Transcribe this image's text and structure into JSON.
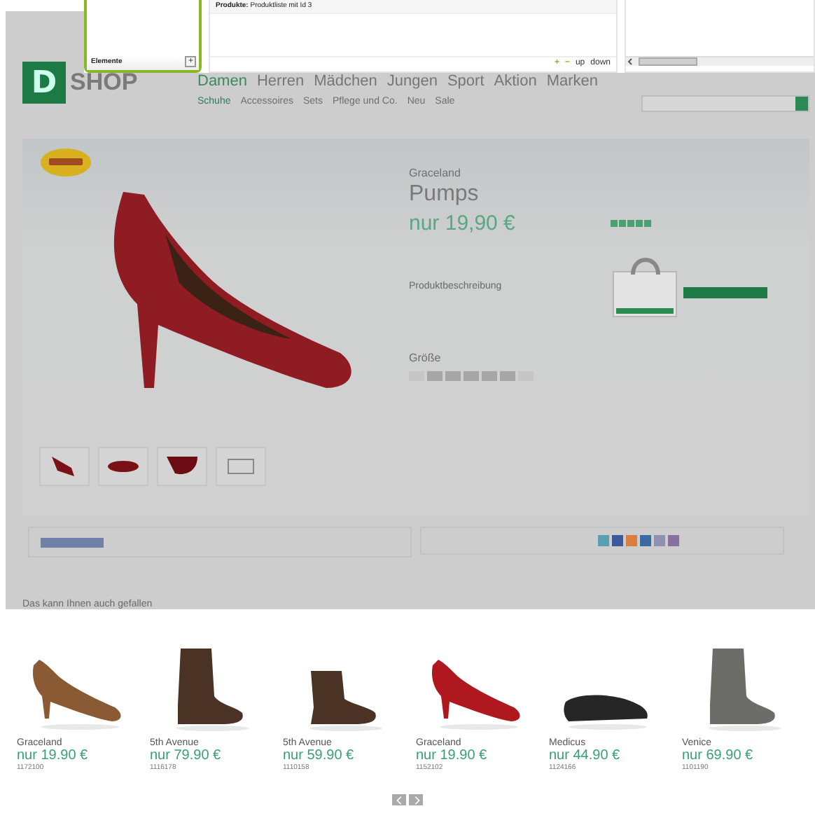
{
  "editor": {
    "elements_panel": {
      "title": "Elemente",
      "add_button": "+"
    },
    "list_panel": {
      "rows": [
        {
          "label": "Produkte:",
          "value": "Produktliste mit Id 3"
        }
      ],
      "buttons": [
        {
          "label": "+",
          "kind": "add"
        },
        {
          "label": "−",
          "kind": "remove"
        },
        {
          "label": "up",
          "kind": "move"
        },
        {
          "label": "down",
          "kind": "move"
        }
      ]
    }
  },
  "shop": {
    "logo": {
      "letter": "D",
      "word": "SHOP"
    },
    "nav": [
      {
        "label": "Damen",
        "selected": true
      },
      {
        "label": "Herren",
        "selected": false
      },
      {
        "label": "Mädchen",
        "selected": false
      },
      {
        "label": "Jungen",
        "selected": false
      },
      {
        "label": "Sport",
        "selected": false
      },
      {
        "label": "Aktion",
        "selected": false
      },
      {
        "label": "Marken",
        "selected": false
      }
    ],
    "subnav": [
      {
        "label": "Schuhe",
        "selected": true
      },
      {
        "label": "Accessoires",
        "selected": false
      },
      {
        "label": "Sets",
        "selected": false
      },
      {
        "label": "Pflege und Co.",
        "selected": false
      },
      {
        "label": "Neu",
        "selected": false
      },
      {
        "label": "Sale",
        "selected": false
      }
    ],
    "product": {
      "brand": "Graceland",
      "name": "Pumps",
      "price": "nur 19,90 €",
      "stars": 5,
      "link": "Produktbeschreibung",
      "size_label": "Größe"
    },
    "footer_heading": "Das kann Ihnen auch gefallen"
  },
  "recommendations": [
    {
      "kind": "pump",
      "color": "#8a5a34",
      "brand": "Graceland",
      "price": "nur 19.90 €",
      "number": "1172100"
    },
    {
      "kind": "boot",
      "color": "#4a3324",
      "brand": "5th Avenue",
      "price": "nur 79.90 €",
      "number": "1116178"
    },
    {
      "kind": "bootie",
      "color": "#4a3324",
      "brand": "5th Avenue",
      "price": "nur 59.90 €",
      "number": "1110158"
    },
    {
      "kind": "pump",
      "color": "#b01820",
      "brand": "Graceland",
      "price": "nur 19.90 €",
      "number": "1152102"
    },
    {
      "kind": "loafer",
      "color": "#262626",
      "brand": "Medicus",
      "price": "nur 44.90 €",
      "number": "1124166"
    },
    {
      "kind": "boot",
      "color": "#6c6c68",
      "brand": "Venice",
      "price": "nur 69.90 €",
      "number": "1101190"
    }
  ]
}
